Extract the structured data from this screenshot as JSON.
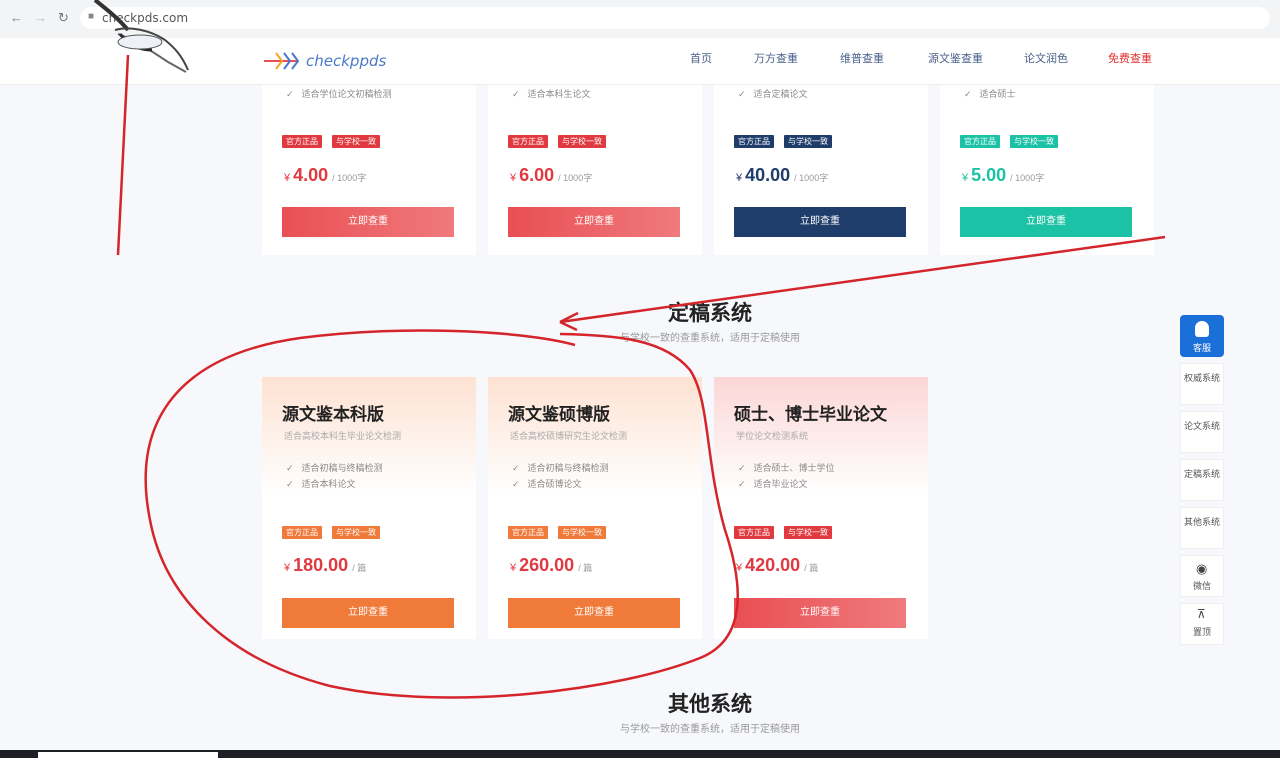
{
  "browser": {
    "back_icon": "arrow-left-icon",
    "forward_icon": "arrow-right-icon",
    "reload_icon": "reload-icon",
    "url": "checkpds.com"
  },
  "header": {
    "logo_text": "checkppds",
    "menu": [
      {
        "label": "首页",
        "color": "#4a5f8a"
      },
      {
        "label": "万方查重",
        "color": "#4a5f8a"
      },
      {
        "label": "维普查重",
        "color": "#4a5f8a"
      },
      {
        "label": "源文鉴查重",
        "color": "#4a5f8a"
      },
      {
        "label": "论文润色",
        "color": "#4a5f8a"
      },
      {
        "label": "免费查重",
        "color": "#e0302f"
      }
    ]
  },
  "top_cards": [
    {
      "feature": "适合学位论文初稿检测",
      "tags": [
        "官方正品",
        "与学校一致"
      ],
      "currency": "¥",
      "price": "4.00",
      "unit": "/ 1000字",
      "button": "立即查重",
      "accent": "#e94f54"
    },
    {
      "feature": "适合本科生论文",
      "tags": [
        "官方正品",
        "与学校一致"
      ],
      "currency": "¥",
      "price": "6.00",
      "unit": "/ 1000字",
      "button": "立即查重",
      "accent": "#e94f54"
    },
    {
      "feature": "适合定稿论文",
      "tags": [
        "官方正品",
        "与学校一致"
      ],
      "currency": "¥",
      "price": "40.00",
      "unit": "/ 1000字",
      "button": "立即查重",
      "accent": "#1f3d6b"
    },
    {
      "feature": "适合硕士",
      "tags": [
        "官方正品",
        "与学校一致"
      ],
      "currency": "¥",
      "price": "5.00",
      "unit": "/ 1000字",
      "button": "立即查重",
      "accent": "#1cc2a6"
    }
  ],
  "section_final": {
    "title": "定稿系统",
    "subtitle": "与学校一致的查重系统，适用于定稿使用"
  },
  "final_cards": [
    {
      "title": "源文鉴本科版",
      "subtitle": "适合高校本科生毕业论文检测",
      "features": [
        "适合初稿与终稿检测",
        "适合本科论文"
      ],
      "tags": [
        "官方正品",
        "与学校一致"
      ],
      "currency": "¥",
      "price": "180.00",
      "unit": "/ 篇",
      "button": "立即查重",
      "accent": "#f07a3a"
    },
    {
      "title": "源文鉴硕博版",
      "subtitle": "适合高校硕博研究生论文检测",
      "features": [
        "适合初稿与终稿检测",
        "适合硕博论文"
      ],
      "tags": [
        "官方正品",
        "与学校一致"
      ],
      "currency": "¥",
      "price": "260.00",
      "unit": "/ 篇",
      "button": "立即查重",
      "accent": "#f07a3a"
    },
    {
      "title": "硕士、博士毕业论文",
      "subtitle": "学位论文检测系统",
      "features": [
        "适合硕士、博士学位",
        "适合毕业论文"
      ],
      "tags": [
        "官方正品",
        "与学校一致"
      ],
      "currency": "¥",
      "price": "420.00",
      "unit": "/ 篇",
      "button": "立即查重",
      "accent": "#e94f54"
    }
  ],
  "section_other": {
    "title": "其他系统",
    "subtitle": "与学校一致的查重系统，适用于定稿使用"
  },
  "sidenav": {
    "top_label": "客服",
    "items": [
      "权威系统",
      "论文系统",
      "定稿系统",
      "其他系统",
      "微信",
      "置顶"
    ]
  },
  "colors": {
    "annotation_red": "#d4252b",
    "side_blue": "#1a6fd8"
  }
}
